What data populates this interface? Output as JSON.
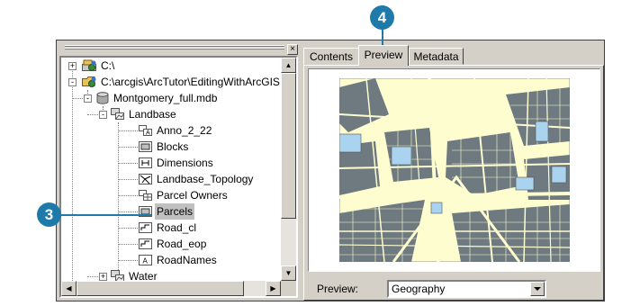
{
  "tree": {
    "items": [
      {
        "label": "C:\\",
        "icon": "drive-icon",
        "expander": "+"
      },
      {
        "label": "C:\\arcgis\\ArcTutor\\EditingWithArcGIS",
        "icon": "folder-connection-icon",
        "expander": "-"
      },
      {
        "label": "Montgomery_full.mdb",
        "icon": "geodatabase-icon",
        "expander": "-"
      },
      {
        "label": "Landbase",
        "icon": "feature-dataset-icon",
        "expander": "-"
      },
      {
        "label": "Anno_2_22",
        "icon": "annotation-class-icon"
      },
      {
        "label": "Blocks",
        "icon": "polygon-feature-class-icon"
      },
      {
        "label": "Dimensions",
        "icon": "dimension-class-icon"
      },
      {
        "label": "Landbase_Topology",
        "icon": "topology-icon"
      },
      {
        "label": "Parcel Owners",
        "icon": "table-icon"
      },
      {
        "label": "Parcels",
        "icon": "polygon-feature-class-icon",
        "selected": true
      },
      {
        "label": "Road_cl",
        "icon": "line-feature-class-icon"
      },
      {
        "label": "Road_eop",
        "icon": "line-feature-class-icon"
      },
      {
        "label": "RoadNames",
        "icon": "annotation-class-icon"
      },
      {
        "label": "Water",
        "icon": "feature-dataset-icon",
        "expander": "+"
      }
    ]
  },
  "tabs": [
    {
      "label": "Contents"
    },
    {
      "label": "Preview",
      "active": true
    },
    {
      "label": "Metadata"
    }
  ],
  "preview": {
    "label": "Preview:",
    "selected": "Geography"
  },
  "callouts": {
    "tree_step": "3",
    "tab_step": "4"
  },
  "colors": {
    "callout": "#1e7aa8",
    "map_land": "#fdfdd0",
    "map_parcels": "#6e7980",
    "map_water": "#a9d3ee"
  }
}
